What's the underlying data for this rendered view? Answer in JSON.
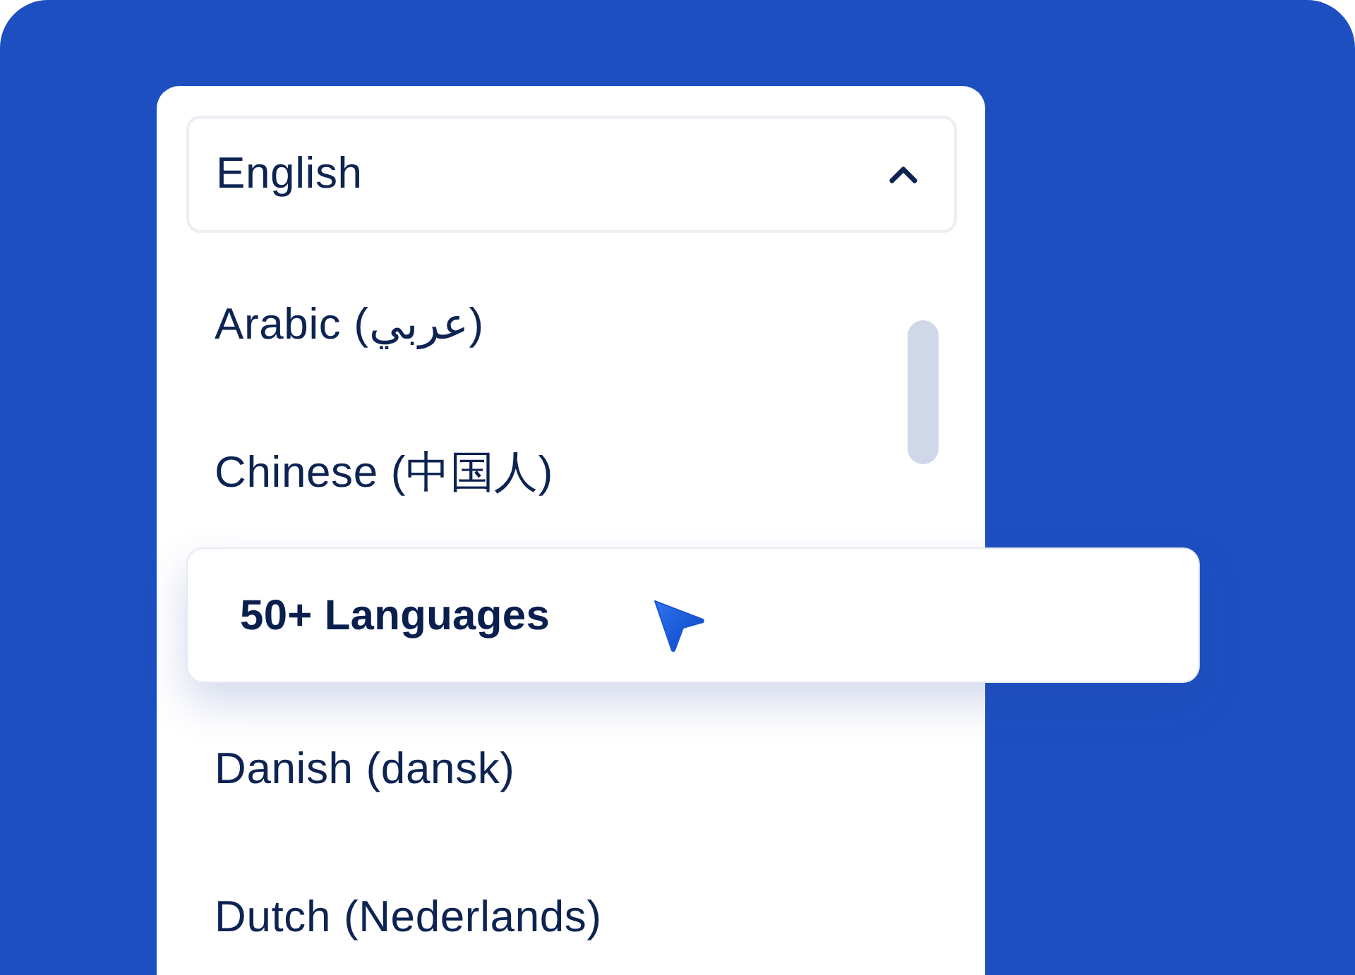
{
  "select": {
    "value": "English",
    "expanded": true
  },
  "options": [
    {
      "label": "Arabic (عربي)",
      "selected": false
    },
    {
      "label": "Chinese (中国人)",
      "selected": false
    },
    {
      "kind": "callout",
      "label": "50+ Languages"
    },
    {
      "label": "Danish (dansk)",
      "selected": false
    },
    {
      "label": "Dutch (Nederlands)",
      "selected": false
    }
  ]
}
